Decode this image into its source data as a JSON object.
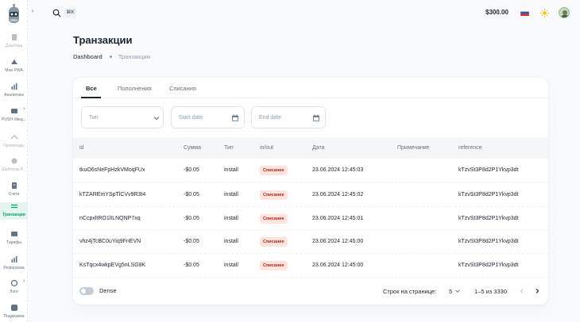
{
  "sidebar": {
    "items": [
      {
        "label": "Дэшборд",
        "icon": "dashboard-icon",
        "dim": true
      },
      {
        "label": "Мои PWA",
        "icon": "pwa-icon"
      },
      {
        "label": "Аналитика",
        "icon": "analytics-icon"
      },
      {
        "label": "PUSH-Увед...",
        "icon": "push-icon",
        "arrow": true
      },
      {
        "label": "Промокоды",
        "icon": "promo-icon",
        "dim": true
      },
      {
        "label": "Шаблоны P...",
        "icon": "templates-icon",
        "dim": true
      },
      {
        "label": "Счета",
        "icon": "invoice-icon"
      },
      {
        "label": "Транзакции",
        "icon": "transactions-icon",
        "active": true
      },
      {
        "label": "Тарифы",
        "icon": "tariffs-icon"
      },
      {
        "label": "Рефералка",
        "icon": "referral-icon"
      },
      {
        "label": "Логи",
        "icon": "logs-icon",
        "arrow": true
      },
      {
        "label": "Поддержка",
        "icon": "support-icon"
      }
    ]
  },
  "header": {
    "search_shortcut": "⌘K",
    "balance": "$300.00"
  },
  "page": {
    "title": "Транзакции",
    "breadcrumb": [
      "Dashboard",
      "Транзакции"
    ]
  },
  "tabs": [
    "Все",
    "Пополнения",
    "Списания"
  ],
  "filters": {
    "type_placeholder": "Тип",
    "start_placeholder": "Start date",
    "end_placeholder": "End date"
  },
  "table": {
    "columns": [
      "id",
      "Сумма",
      "Тип",
      "in/out",
      "Дата",
      "Примечание",
      "reference"
    ],
    "rows": [
      {
        "id": "tkuO6sNeFpHzkVMoqFUx",
        "amount": "-$0.05",
        "type": "install",
        "inout": "Списание",
        "date": "23.06.2024 12:45:03",
        "note": "",
        "reference": "kTzvSt3P8d2P1Ykvp3dt"
      },
      {
        "id": "kTZAREmYSpTlCVv9R3t4",
        "amount": "-$0.05",
        "type": "install",
        "inout": "Списание",
        "date": "23.06.2024 12:45:02",
        "note": "",
        "reference": "kTzvSt3P8d2P1Ykvp3dt"
      },
      {
        "id": "nCcpxltRO1lILNQNP7xq",
        "amount": "-$0.05",
        "type": "install",
        "inout": "Списание",
        "date": "23.06.2024 12:45:01",
        "note": "",
        "reference": "kTzvSt3P8d2P1Ykvp3dt"
      },
      {
        "id": "vhz4jTcBC0uYiq9FnEVN",
        "amount": "-$0.05",
        "type": "install",
        "inout": "Списание",
        "date": "23.06.2024 12:45:00",
        "note": "",
        "reference": "kTzvSt3P8d2P1Ykvp3dt"
      },
      {
        "id": "KsTqcx4wkpEVg5nLSG8K",
        "amount": "-$0.05",
        "type": "install",
        "inout": "Списание",
        "date": "23.06.2024 12:45:00",
        "note": "",
        "reference": "kTzvSt3P8d2P1Ykvp3dt"
      }
    ]
  },
  "footer": {
    "dense_label": "Dense",
    "rows_per_page_label": "Строк на странице:",
    "rows_per_page": "5",
    "range": "1–5 из 3330"
  },
  "colors": {
    "accent": "#00a76f",
    "badge_bg": "#ffe4de",
    "badge_text": "#b71d18"
  }
}
